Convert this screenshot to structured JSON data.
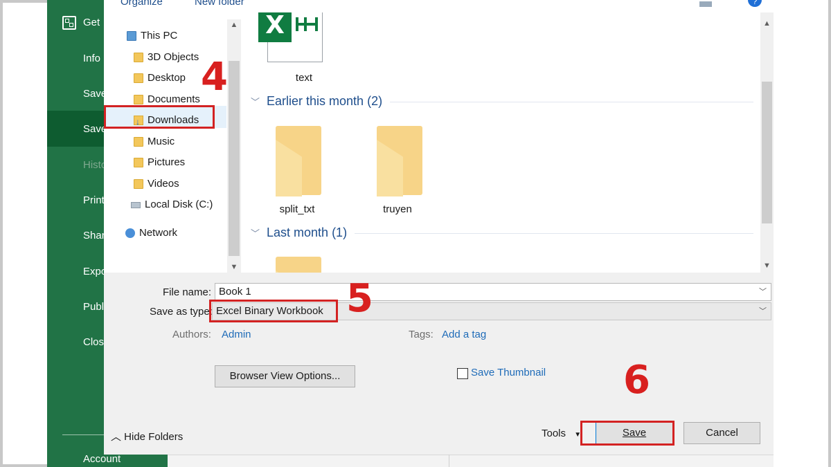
{
  "backstage": {
    "items": [
      {
        "label": "Get",
        "dim": false
      },
      {
        "label": "Info",
        "dim": false
      },
      {
        "label": "Save",
        "dim": false
      },
      {
        "label": "Save",
        "dim": false
      },
      {
        "label": "Histo",
        "dim": true
      },
      {
        "label": "Print",
        "dim": false
      },
      {
        "label": "Shar",
        "dim": false
      },
      {
        "label": "Expo",
        "dim": false
      },
      {
        "label": "Publ",
        "dim": false
      },
      {
        "label": "Clos",
        "dim": false
      },
      {
        "label": "Account",
        "dim": false
      }
    ],
    "accent": "#217346"
  },
  "toolbar": {
    "organize": "Organize",
    "new_folder": "New folder",
    "help": "?"
  },
  "nav": {
    "items": [
      {
        "label": "This PC",
        "icon": "computer-icon"
      },
      {
        "label": "3D Objects",
        "icon": "folder-icon"
      },
      {
        "label": "Desktop",
        "icon": "folder-icon"
      },
      {
        "label": "Documents",
        "icon": "folder-icon"
      },
      {
        "label": "Downloads",
        "icon": "downloads-icon",
        "selected": true
      },
      {
        "label": "Music",
        "icon": "music-folder-icon"
      },
      {
        "label": "Pictures",
        "icon": "pictures-folder-icon"
      },
      {
        "label": "Videos",
        "icon": "videos-folder-icon"
      },
      {
        "label": "Local Disk (C:)",
        "icon": "disk-icon"
      },
      {
        "label": "Network",
        "icon": "network-icon"
      }
    ]
  },
  "content": {
    "top_file": {
      "name": "text",
      "icon": "excel-file-icon"
    },
    "groups": [
      {
        "title": "Earlier this month (2)",
        "files": [
          {
            "name": "split_txt",
            "icon": "folder-icon"
          },
          {
            "name": "truyen",
            "icon": "folder-icon"
          }
        ]
      },
      {
        "title": "Last month (1)",
        "files": []
      }
    ]
  },
  "form": {
    "file_name_label": "File name:",
    "file_name_value": "Book 1",
    "save_type_label": "Save as type:",
    "save_type_value": "Excel Binary Workbook",
    "authors_label": "Authors:",
    "authors_value": "Admin",
    "tags_label": "Tags:",
    "tags_value": "Add a tag",
    "browser_view_button": "Browser View Options...",
    "save_thumbnail_label": "Save Thumbnail",
    "hide_folders": "Hide Folders",
    "tools_label": "Tools",
    "save_button": "Save",
    "cancel_button": "Cancel"
  },
  "annotations": {
    "step4": "4",
    "step5": "5",
    "step6": "6",
    "color": "#d32222"
  }
}
